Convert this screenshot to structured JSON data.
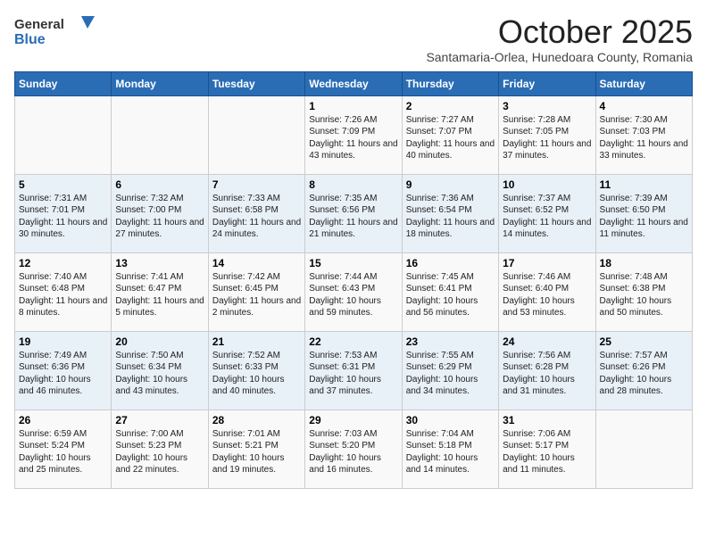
{
  "header": {
    "logo_line1": "General",
    "logo_line2": "Blue",
    "month": "October 2025",
    "location": "Santamaria-Orlea, Hunedoara County, Romania"
  },
  "weekdays": [
    "Sunday",
    "Monday",
    "Tuesday",
    "Wednesday",
    "Thursday",
    "Friday",
    "Saturday"
  ],
  "weeks": [
    [
      {
        "day": "",
        "info": ""
      },
      {
        "day": "",
        "info": ""
      },
      {
        "day": "",
        "info": ""
      },
      {
        "day": "1",
        "info": "Sunrise: 7:26 AM\nSunset: 7:09 PM\nDaylight: 11 hours and 43 minutes."
      },
      {
        "day": "2",
        "info": "Sunrise: 7:27 AM\nSunset: 7:07 PM\nDaylight: 11 hours and 40 minutes."
      },
      {
        "day": "3",
        "info": "Sunrise: 7:28 AM\nSunset: 7:05 PM\nDaylight: 11 hours and 37 minutes."
      },
      {
        "day": "4",
        "info": "Sunrise: 7:30 AM\nSunset: 7:03 PM\nDaylight: 11 hours and 33 minutes."
      }
    ],
    [
      {
        "day": "5",
        "info": "Sunrise: 7:31 AM\nSunset: 7:01 PM\nDaylight: 11 hours and 30 minutes."
      },
      {
        "day": "6",
        "info": "Sunrise: 7:32 AM\nSunset: 7:00 PM\nDaylight: 11 hours and 27 minutes."
      },
      {
        "day": "7",
        "info": "Sunrise: 7:33 AM\nSunset: 6:58 PM\nDaylight: 11 hours and 24 minutes."
      },
      {
        "day": "8",
        "info": "Sunrise: 7:35 AM\nSunset: 6:56 PM\nDaylight: 11 hours and 21 minutes."
      },
      {
        "day": "9",
        "info": "Sunrise: 7:36 AM\nSunset: 6:54 PM\nDaylight: 11 hours and 18 minutes."
      },
      {
        "day": "10",
        "info": "Sunrise: 7:37 AM\nSunset: 6:52 PM\nDaylight: 11 hours and 14 minutes."
      },
      {
        "day": "11",
        "info": "Sunrise: 7:39 AM\nSunset: 6:50 PM\nDaylight: 11 hours and 11 minutes."
      }
    ],
    [
      {
        "day": "12",
        "info": "Sunrise: 7:40 AM\nSunset: 6:48 PM\nDaylight: 11 hours and 8 minutes."
      },
      {
        "day": "13",
        "info": "Sunrise: 7:41 AM\nSunset: 6:47 PM\nDaylight: 11 hours and 5 minutes."
      },
      {
        "day": "14",
        "info": "Sunrise: 7:42 AM\nSunset: 6:45 PM\nDaylight: 11 hours and 2 minutes."
      },
      {
        "day": "15",
        "info": "Sunrise: 7:44 AM\nSunset: 6:43 PM\nDaylight: 10 hours and 59 minutes."
      },
      {
        "day": "16",
        "info": "Sunrise: 7:45 AM\nSunset: 6:41 PM\nDaylight: 10 hours and 56 minutes."
      },
      {
        "day": "17",
        "info": "Sunrise: 7:46 AM\nSunset: 6:40 PM\nDaylight: 10 hours and 53 minutes."
      },
      {
        "day": "18",
        "info": "Sunrise: 7:48 AM\nSunset: 6:38 PM\nDaylight: 10 hours and 50 minutes."
      }
    ],
    [
      {
        "day": "19",
        "info": "Sunrise: 7:49 AM\nSunset: 6:36 PM\nDaylight: 10 hours and 46 minutes."
      },
      {
        "day": "20",
        "info": "Sunrise: 7:50 AM\nSunset: 6:34 PM\nDaylight: 10 hours and 43 minutes."
      },
      {
        "day": "21",
        "info": "Sunrise: 7:52 AM\nSunset: 6:33 PM\nDaylight: 10 hours and 40 minutes."
      },
      {
        "day": "22",
        "info": "Sunrise: 7:53 AM\nSunset: 6:31 PM\nDaylight: 10 hours and 37 minutes."
      },
      {
        "day": "23",
        "info": "Sunrise: 7:55 AM\nSunset: 6:29 PM\nDaylight: 10 hours and 34 minutes."
      },
      {
        "day": "24",
        "info": "Sunrise: 7:56 AM\nSunset: 6:28 PM\nDaylight: 10 hours and 31 minutes."
      },
      {
        "day": "25",
        "info": "Sunrise: 7:57 AM\nSunset: 6:26 PM\nDaylight: 10 hours and 28 minutes."
      }
    ],
    [
      {
        "day": "26",
        "info": "Sunrise: 6:59 AM\nSunset: 5:24 PM\nDaylight: 10 hours and 25 minutes."
      },
      {
        "day": "27",
        "info": "Sunrise: 7:00 AM\nSunset: 5:23 PM\nDaylight: 10 hours and 22 minutes."
      },
      {
        "day": "28",
        "info": "Sunrise: 7:01 AM\nSunset: 5:21 PM\nDaylight: 10 hours and 19 minutes."
      },
      {
        "day": "29",
        "info": "Sunrise: 7:03 AM\nSunset: 5:20 PM\nDaylight: 10 hours and 16 minutes."
      },
      {
        "day": "30",
        "info": "Sunrise: 7:04 AM\nSunset: 5:18 PM\nDaylight: 10 hours and 14 minutes."
      },
      {
        "day": "31",
        "info": "Sunrise: 7:06 AM\nSunset: 5:17 PM\nDaylight: 10 hours and 11 minutes."
      },
      {
        "day": "",
        "info": ""
      }
    ]
  ]
}
